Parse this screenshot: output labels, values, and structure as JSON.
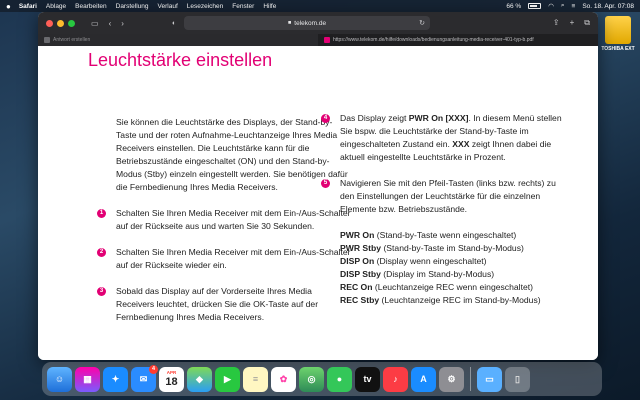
{
  "menubar": {
    "app": "Safari",
    "items": [
      "Ablage",
      "Bearbeiten",
      "Darstellung",
      "Verlauf",
      "Lesezeichen",
      "Fenster",
      "Hilfe"
    ],
    "battery": "66 %",
    "datetime": "So. 18. Apr.  07:08"
  },
  "desktop": {
    "drive_label": "TOSHIBA EXT"
  },
  "browser": {
    "url": "telekom.de",
    "tabs": [
      {
        "label": "Antwort erstellen"
      },
      {
        "label": "https://www.telekom.de/hilfe/downloads/bedienungsanleitung-media-receiver-401-typ-b.pdf"
      }
    ]
  },
  "document": {
    "title": "Leuchtstärke einstellen",
    "intro": "Sie können die Leuchtstärke des Displays, der Stand-by-Taste und der roten Aufnahme-Leuchtanzeige Ihres Media Receivers einstellen. Die Leuchtstärke kann für die Betriebszustände eingeschaltet (ON) und den Stand-by-Modus (Stby) einzeln eingestellt werden. Sie benötigen dafür die Fernbedienung Ihres Media Receivers.",
    "steps": [
      {
        "num": "1",
        "text": "Schalten Sie Ihren Media Receiver mit dem Ein-/Aus-Schalter auf der Rückseite aus und warten Sie 30 Sekunden."
      },
      {
        "num": "2",
        "text": "Schalten Sie Ihren Media Receiver mit dem Ein-/Aus-Schalter auf der Rückseite wieder ein."
      },
      {
        "num": "3",
        "text": "Sobald das Display auf der Vorderseite Ihres Media Receivers leuchtet, drücken Sie die OK-Taste auf der Fernbedienung Ihres Media Receivers."
      },
      {
        "num": "4",
        "text_a": "Das Display zeigt ",
        "bold_a": "PWR On [XXX]",
        "text_b": ". In diesem Menü stellen Sie bspw. die Leuchtstärke der Stand-by-Taste im eingeschalteten Zustand ein. ",
        "bold_b": "XXX",
        "text_c": " zeigt Ihnen dabei die aktuell eingestellte Leuchtstärke in Prozent."
      },
      {
        "num": "5",
        "text": "Navigieren Sie mit den Pfeil-Tasten (links bzw. rechts) zu den Einstellungen der Leuchtstärke für die einzelnen Elemente bzw. Betriebszustände."
      }
    ],
    "modes": [
      {
        "code": "PWR On",
        "desc": " (Stand-by-Taste wenn eingeschaltet)"
      },
      {
        "code": "PWR Stby",
        "desc": " (Stand-by-Taste im Stand-by-Modus)"
      },
      {
        "code": "DISP On",
        "desc": " (Display wenn eingeschaltet)"
      },
      {
        "code": "DISP Stby",
        "desc": " (Display im Stand-by-Modus)"
      },
      {
        "code": "REC On",
        "desc": " (Leuchtanzeige REC wenn eingeschaltet)"
      },
      {
        "code": "REC Stby",
        "desc": " (Leuchtanzeige REC im Stand-by-Modus)"
      }
    ],
    "rec_word": "REC"
  },
  "dock": {
    "mail_badge": "4",
    "calendar_month": "APR",
    "calendar_day": "18",
    "tv_label": "tv"
  }
}
